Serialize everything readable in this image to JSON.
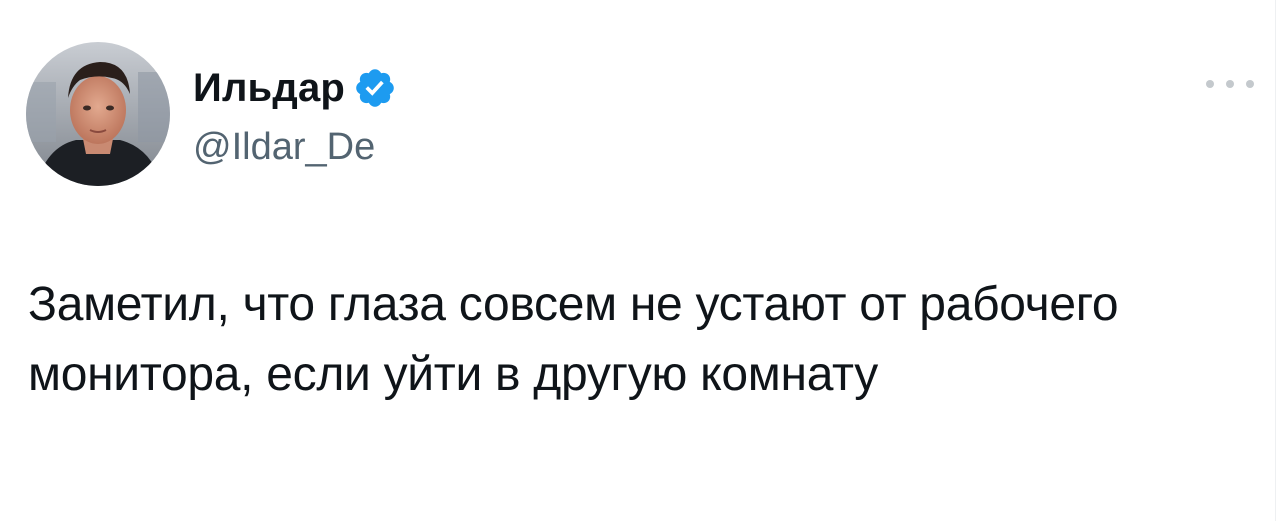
{
  "author": {
    "name": "Ильдар",
    "handle": "@Ildar_De",
    "verified": true
  },
  "tweet": {
    "text": "Заметил, что глаза совсем не устают от рабочего монитора, если уйти в другую комнату"
  },
  "icons": {
    "verified": "verified-badge-icon",
    "more": "more-horizontal-icon"
  },
  "colors": {
    "verified_badge": "#1d9bf0",
    "text_primary": "#0f1419",
    "text_secondary": "#536471"
  }
}
